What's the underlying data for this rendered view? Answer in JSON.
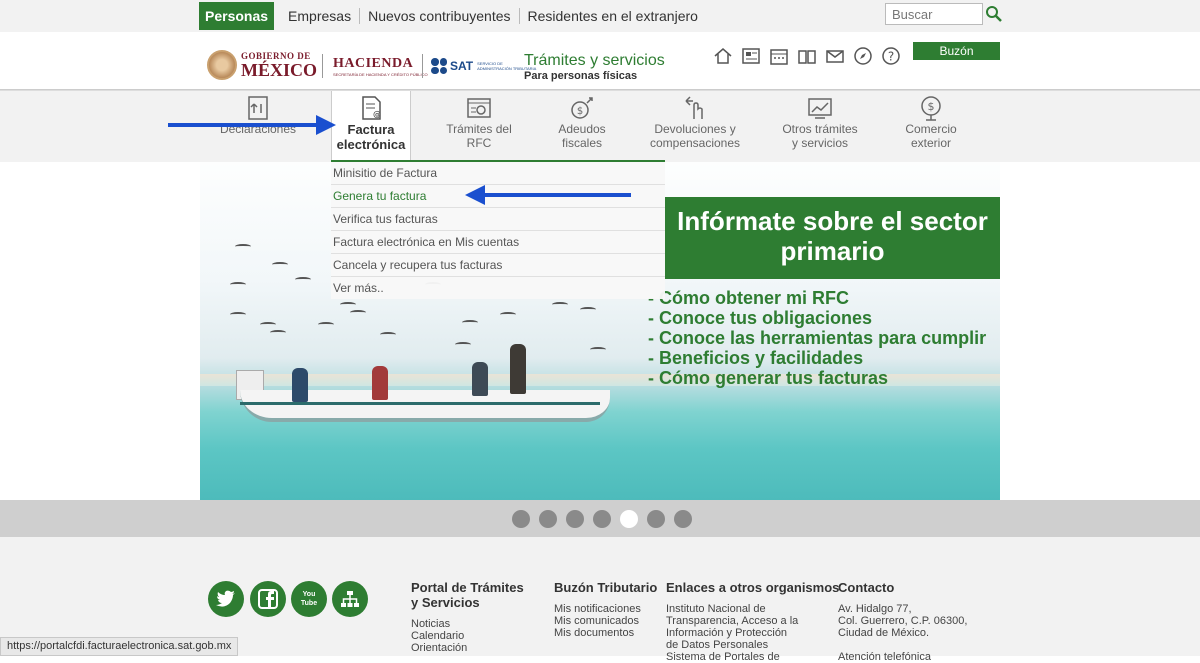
{
  "topbar": {
    "tabs": [
      "Personas",
      "Empresas",
      "Nuevos contribuyentes",
      "Residentes en el extranjero"
    ],
    "search_placeholder": "Buscar"
  },
  "header": {
    "gob_line1": "GOBIERNO DE",
    "gob_line2": "MÉXICO",
    "hacienda": "HACIENDA",
    "hacienda_sub": "SECRETARÍA DE HACIENDA Y CRÉDITO PÚBLICO",
    "sat": "SAT",
    "sat_sub": "SERVICIO DE ADMINISTRACIÓN TRIBUTARIA",
    "title": "Trámites y servicios",
    "subtitle": "Para personas físicas",
    "buzon": "Buzón Tributario",
    "icons": [
      "home-icon",
      "newspaper-icon",
      "calendar-icon",
      "book-icon",
      "mail-icon",
      "compass-icon",
      "help-icon"
    ]
  },
  "nav": {
    "items": [
      {
        "l1": "Declaraciones",
        "l2": ""
      },
      {
        "l1": "Factura",
        "l2": "electrónica"
      },
      {
        "l1": "Trámites del",
        "l2": "RFC"
      },
      {
        "l1": "Adeudos",
        "l2": "fiscales"
      },
      {
        "l1": "Devoluciones y",
        "l2": "compensaciones"
      },
      {
        "l1": "Otros trámites",
        "l2": "y servicios"
      },
      {
        "l1": "Comercio",
        "l2": "exterior"
      }
    ]
  },
  "dropdown": {
    "items": [
      "Minisitio de Factura",
      "Genera tu factura",
      "Verifica tus facturas",
      "Factura electrónica en Mis cuentas",
      "Cancela y recupera tus facturas",
      "Ver más.."
    ]
  },
  "hero": {
    "headline": "Infórmate sobre el sector primario",
    "bullets": [
      "- Cómo obtener mi RFC",
      "- Conoce tus obligaciones",
      "- Conoce las herramientas para cumplir",
      "- Beneficios y facilidades",
      "- Cómo generar tus facturas"
    ]
  },
  "carousel": {
    "count": 7,
    "active_index": 4
  },
  "footer": {
    "social": [
      "twitter-icon",
      "facebook-icon",
      "youtube-icon",
      "sitemap-icon"
    ],
    "youtube_label": "You Tube",
    "col1": {
      "h1": "Portal de Trámites",
      "h2": "y Servicios",
      "links": [
        "Noticias",
        "Calendario",
        "Orientación"
      ]
    },
    "col2": {
      "h": "Buzón Tributario",
      "links": [
        "Mis notificaciones",
        "Mis comunicados",
        "Mis documentos"
      ]
    },
    "col3": {
      "h": "Enlaces a otros organismos",
      "links": [
        "Instituto Nacional de",
        "Transparencia, Acceso a la",
        "Información y Protección",
        "de Datos Personales",
        "Sistema de Portales de"
      ]
    },
    "col4": {
      "h": "Contacto",
      "links": [
        "Av. Hidalgo 77,",
        "Col. Guerrero, C.P. 06300,",
        "Ciudad de México.",
        "",
        "Atención telefónica"
      ]
    }
  },
  "status_url": "https://portalcfdi.facturaelectronica.sat.gob.mx",
  "colors": {
    "green": "#2e7d32",
    "arrow": "#1a4fcf",
    "guinda": "#7a1b2b"
  }
}
